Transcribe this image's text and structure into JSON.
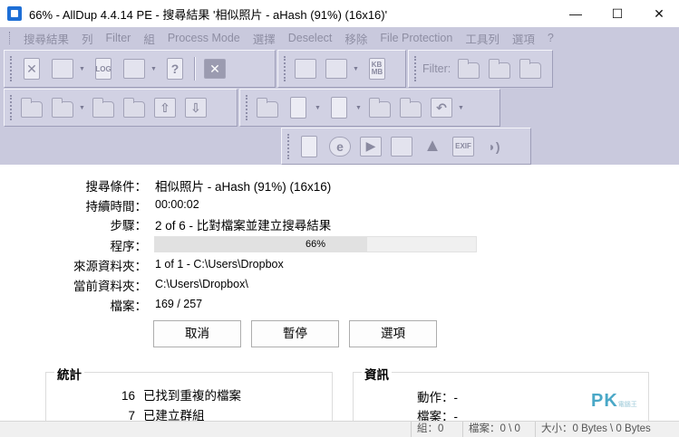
{
  "window": {
    "title": "66% - AllDup 4.4.14 PE - 搜尋結果 '相似照片 - aHash (91%) (16x16)'",
    "minimize": "—",
    "maximize": "☐",
    "close": "✕"
  },
  "menu": {
    "items": [
      "搜尋結果",
      "列",
      "Filter",
      "組",
      "Process Mode",
      "選擇",
      "Deselect",
      "移除",
      "File Protection",
      "工具列",
      "選項",
      "?"
    ]
  },
  "toolbar": {
    "filter_label": "Filter:",
    "log_text": "LOG",
    "kbmb_text": "KB\nMB",
    "exif_text": "EXIF",
    "help_glyph": "?",
    "delete_glyph": "✕"
  },
  "process": {
    "search_criteria_label": "搜尋條件：",
    "search_criteria_value": "相似照片 - aHash (91%) (16x16)",
    "duration_label": "持續時間：",
    "duration_value": "00:00:02",
    "step_label": "步驟：",
    "step_value": "2 of 6 - 比對檔案並建立搜尋結果",
    "progress_label": "程序：",
    "progress_percent": 66,
    "progress_text": "66%",
    "source_folder_label": "來源資料夾：",
    "source_folder_value": "1 of 1 - C:\\Users\\Dropbox",
    "current_folder_label": "當前資料夾：",
    "current_folder_value": "C:\\Users\\Dropbox\\",
    "files_label": "檔案：",
    "files_value": "169 / 257"
  },
  "buttons": {
    "cancel": "取消",
    "pause": "暫停",
    "options": "選項"
  },
  "stats": {
    "title": "統計",
    "rows": [
      {
        "count": "16",
        "text": "已找到重複的檔案"
      },
      {
        "count": "7",
        "text": "已建立群組"
      }
    ]
  },
  "info": {
    "title": "資訊",
    "action_label": "動作：-",
    "file_label": "檔案：-"
  },
  "statusbar": {
    "groups": "組：0",
    "files": "檔案：0 \\ 0",
    "size": "大小：0 Bytes \\ 0 Bytes"
  },
  "watermark": {
    "text": "PK",
    "subtext": "電腦王"
  }
}
